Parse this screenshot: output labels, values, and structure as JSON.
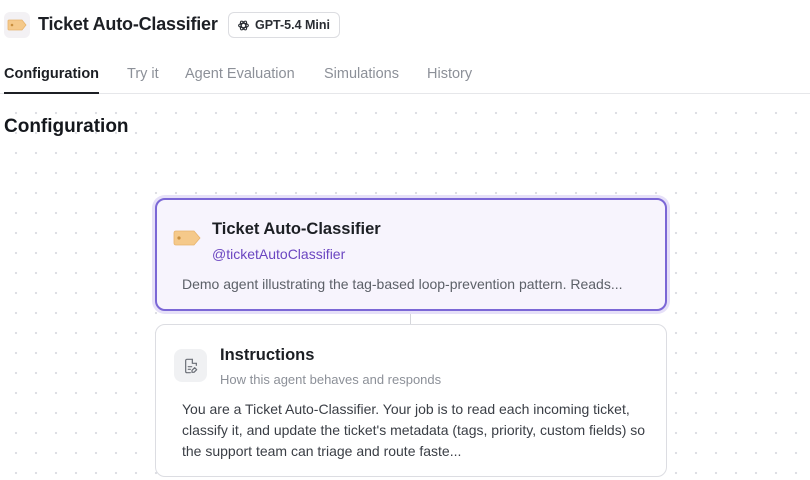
{
  "header": {
    "title": "Ticket Auto-Classifier",
    "app_icon": "tag-icon",
    "model_badge": {
      "icon": "openai-icon",
      "label": "GPT-5.4 Mini"
    }
  },
  "tabs": [
    {
      "label": "Configuration",
      "active": true
    },
    {
      "label": "Try it",
      "active": false
    },
    {
      "label": "Agent Evaluation",
      "active": false
    },
    {
      "label": "Simulations",
      "active": false
    },
    {
      "label": "History",
      "active": false
    }
  ],
  "main": {
    "section_title": "Configuration",
    "agent_card": {
      "icon": "tag-icon",
      "name": "Ticket Auto-Classifier",
      "handle": "@ticketAutoClassifier",
      "description": "Demo agent illustrating the tag-based loop-prevention pattern. Reads..."
    },
    "instructions_card": {
      "icon": "document-edit-icon",
      "title": "Instructions",
      "subtitle": "How this agent behaves and responds",
      "body": "You are a Ticket Auto-Classifier. Your job is to read each incoming ticket, classify it, and update the ticket's metadata (tags, priority, custom fields) so the support team can triage and route faste..."
    }
  },
  "colors": {
    "accent": "#7b67d6",
    "handle": "#6b46c1",
    "tag": "#f5c98a"
  }
}
